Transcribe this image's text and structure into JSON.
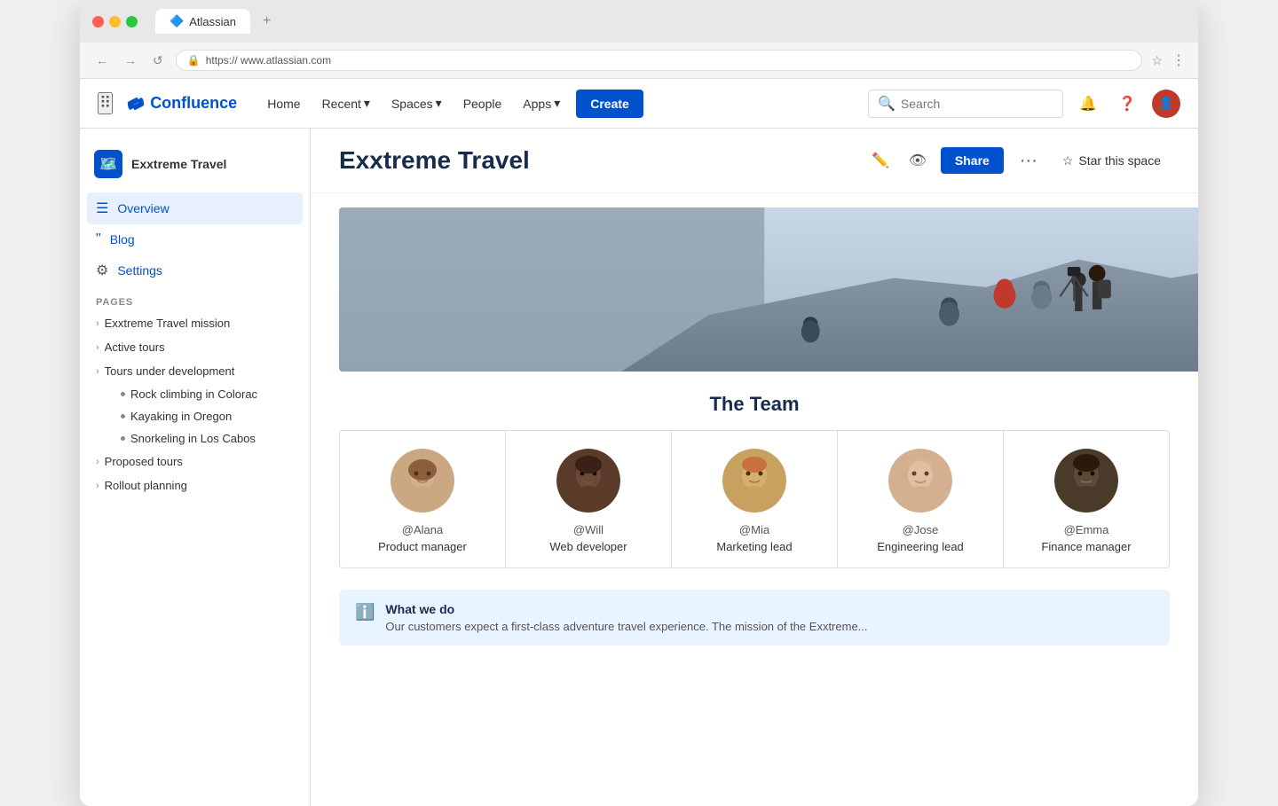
{
  "browser": {
    "tab_title": "Atlassian",
    "tab_plus": "+",
    "address": "https:// www.atlassian.com",
    "back_btn": "←",
    "forward_btn": "→",
    "reload_btn": "↺"
  },
  "nav": {
    "logo_text": "Confluence",
    "home": "Home",
    "recent": "Recent",
    "spaces": "Spaces",
    "people": "People",
    "apps": "Apps",
    "create": "Create",
    "search_placeholder": "Search"
  },
  "sidebar": {
    "space_name": "Exxtreme Travel",
    "overview": "Overview",
    "blog": "Blog",
    "settings": "Settings",
    "pages_label": "PAGES",
    "pages": [
      {
        "label": "Exxtreme Travel mission",
        "level": 0
      },
      {
        "label": "Active tours",
        "level": 0
      },
      {
        "label": "Tours under development",
        "level": 0
      },
      {
        "label": "Rock climbing in Colorac",
        "level": 1
      },
      {
        "label": "Kayaking in Oregon",
        "level": 1
      },
      {
        "label": "Snorkeling in Los Cabos",
        "level": 1
      },
      {
        "label": "Proposed tours",
        "level": 0
      },
      {
        "label": "Rollout planning",
        "level": 0
      }
    ]
  },
  "content": {
    "title": "Exxtreme Travel",
    "share_btn": "Share",
    "star_btn": "Star this space",
    "more_btn": "···"
  },
  "team": {
    "title": "The Team",
    "members": [
      {
        "handle": "@Alana",
        "role": "Product manager"
      },
      {
        "handle": "@Will",
        "role": "Web developer"
      },
      {
        "handle": "@Mia",
        "role": "Marketing lead"
      },
      {
        "handle": "@Jose",
        "role": "Engineering lead"
      },
      {
        "handle": "@Emma",
        "role": "Finance manager"
      }
    ]
  },
  "info": {
    "title": "What we do",
    "text": "Our customers expect a first-class adventure travel experience. The mission of the Exxtreme..."
  }
}
